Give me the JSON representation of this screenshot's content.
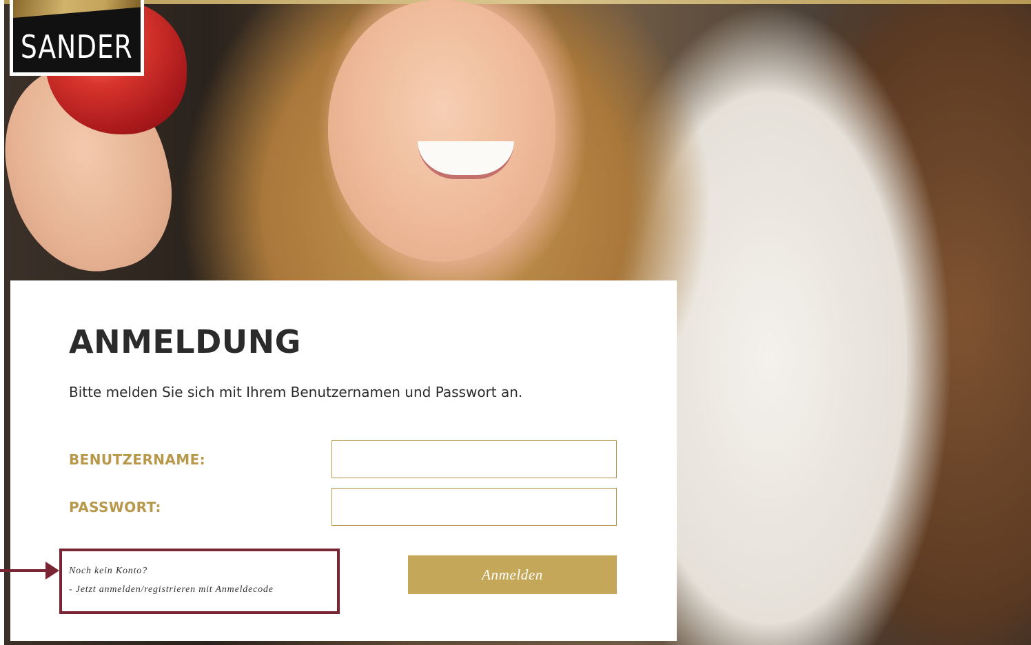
{
  "brand": {
    "logo_text": "SANDER"
  },
  "login": {
    "title": "ANMELDUNG",
    "subtitle": "Bitte melden Sie sich mit Ihrem Benutzernamen und Passwort an.",
    "username_label": "BENUTZERNAME:",
    "username_value": "",
    "password_label": "PASSWORT:",
    "password_value": "",
    "submit_label": "Anmelden",
    "no_account_text": "Noch kein Konto?",
    "register_link_text": "- Jetzt anmelden/registrieren mit Anmeldecode"
  },
  "colors": {
    "accent_gold": "#c4a758",
    "label_gold": "#b8984a",
    "annotation": "#7a2534",
    "text_dark": "#2b2b2b"
  }
}
